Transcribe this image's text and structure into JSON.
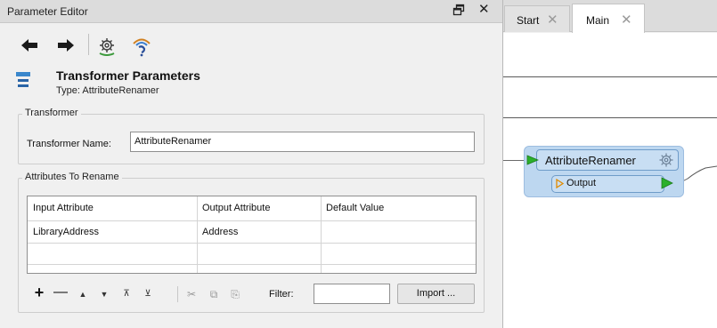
{
  "panel": {
    "title": "Parameter Editor",
    "close_glyph": "✕",
    "toolbar": {
      "back_icon": "arrow-left-icon",
      "forward_icon": "arrow-right-icon",
      "settings_icon": "gear-icon",
      "wizard_icon": "wizard-icon"
    },
    "header": {
      "icon": "transformer-icon",
      "title": "Transformer Parameters",
      "type_line": "Type: AttributeRenamer"
    }
  },
  "transformer_group": {
    "label": "Transformer",
    "name_label": "Transformer Name:",
    "name_value": "AttributeRenamer"
  },
  "attributes_group": {
    "label": "Attributes To Rename",
    "columns": [
      "Input Attribute",
      "Output Attribute",
      "Default Value"
    ],
    "rows": [
      [
        "LibraryAddress",
        "Address",
        ""
      ]
    ]
  },
  "table_controls": {
    "add": "+",
    "remove": "—",
    "move_up": "▲",
    "move_down": "▼",
    "move_top": "⊼",
    "move_bottom": "⊻",
    "cut": "✂",
    "copy": "⧉",
    "paste": "⎘",
    "filter_label": "Filter:",
    "filter_value": "",
    "import_label": "Import ..."
  },
  "canvas": {
    "tabs": [
      {
        "label": "Start",
        "close": "✕",
        "active": false
      },
      {
        "label": "Main",
        "close": "✕",
        "active": true
      }
    ],
    "node": {
      "title": "AttributeRenamer",
      "output_port": "Output",
      "gear_icon": "gear-icon"
    }
  },
  "colors": {
    "node_fill": "#bdd7f0",
    "node_border": "#6f9cc9",
    "port_arrow": "#2bb02b",
    "panel_bg": "#f0f0f0",
    "canvas_bg": "#ffffff"
  }
}
